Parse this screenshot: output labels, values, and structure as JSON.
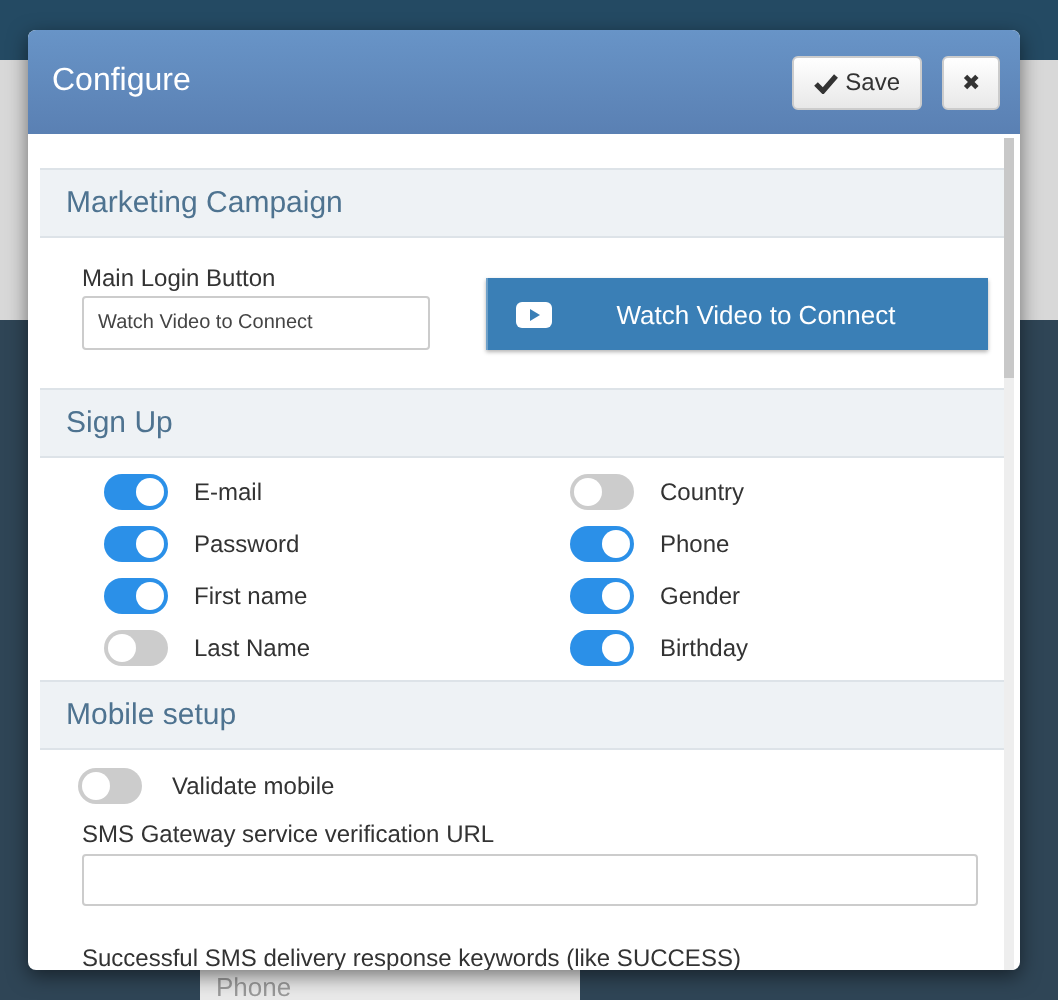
{
  "background": {
    "field_placeholder": "Phone"
  },
  "dialog": {
    "title": "Configure",
    "save_label": "Save",
    "close_label": "✖"
  },
  "marketing": {
    "heading": "Marketing Campaign",
    "field_label": "Main Login Button",
    "field_value": "Watch Video to Connect",
    "preview_label": "Watch Video to Connect"
  },
  "signup": {
    "heading": "Sign Up",
    "toggles": [
      {
        "label": "E-mail",
        "on": true
      },
      {
        "label": "Country",
        "on": false
      },
      {
        "label": "Password",
        "on": true
      },
      {
        "label": "Phone",
        "on": true
      },
      {
        "label": "First name",
        "on": true
      },
      {
        "label": "Gender",
        "on": true
      },
      {
        "label": "Last Name",
        "on": false
      },
      {
        "label": "Birthday",
        "on": true
      }
    ]
  },
  "mobile": {
    "heading": "Mobile setup",
    "validate": {
      "label": "Validate mobile",
      "on": false
    },
    "url_label": "SMS Gateway service verification URL",
    "keywords_label": "Successful SMS delivery response keywords (like SUCCESS)"
  }
}
